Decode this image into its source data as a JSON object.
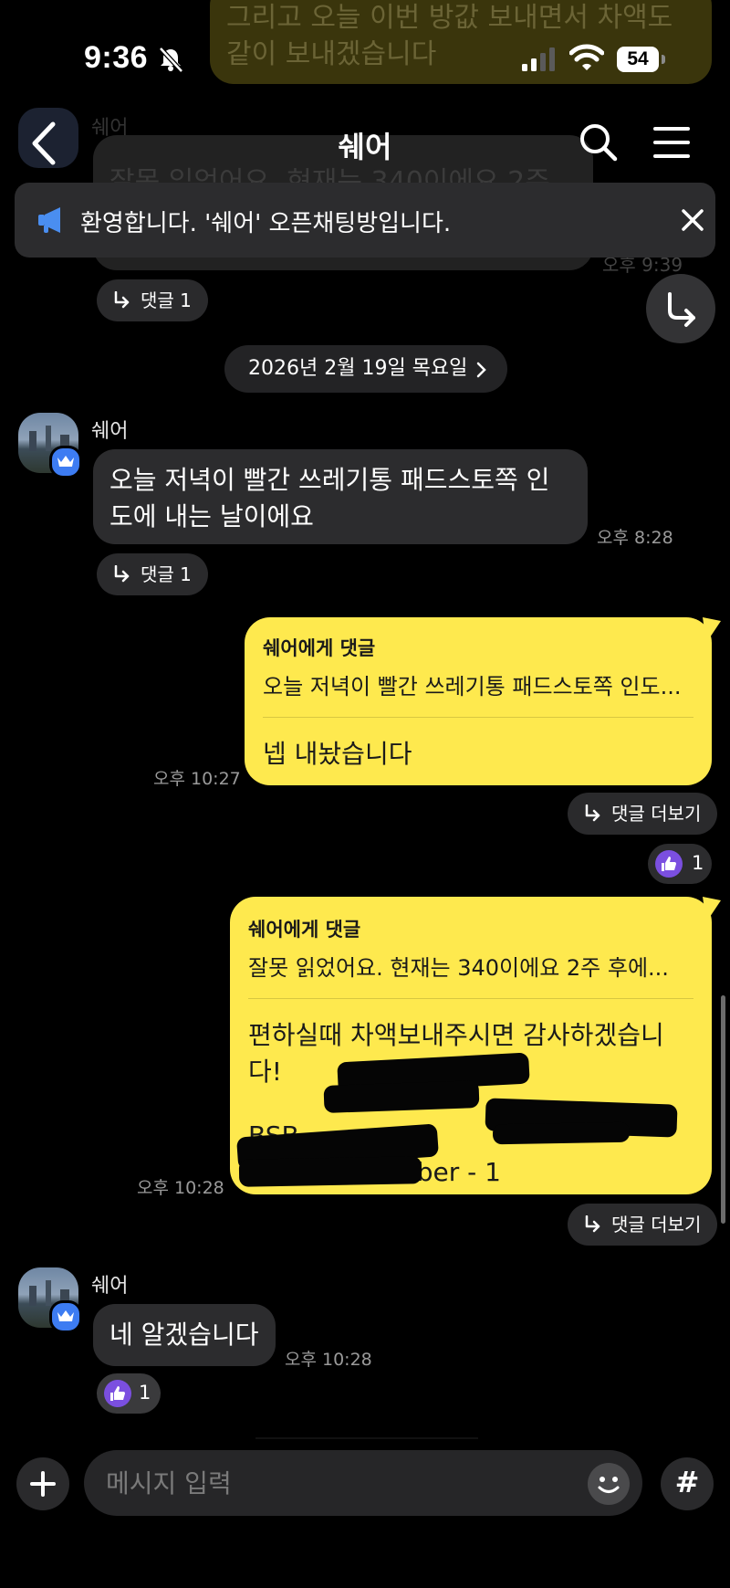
{
  "status_bar": {
    "time": "9:36",
    "battery": "54"
  },
  "ghost": {
    "yellow_text": "그리고 오늘 이번 방값 보내면서 차액도 같이 보내겠습니다",
    "gray_text": "잘못 읽었어요. 현재는 340이에요 2주 후에",
    "name": "쉐어",
    "time": "오후 9:39"
  },
  "header": {
    "title": "쉐어"
  },
  "notice": {
    "text": "환영합니다. '쉐어' 오픈채팅방입니다."
  },
  "labels": {
    "reply_count_label": "댓글 1",
    "more_replies_label": "댓글 더보기"
  },
  "date_divider": "2026년 2월 19일 목요일",
  "messages": [
    {
      "sender": "쉐어",
      "text": "오늘 저녁이 빨간 쓰레기통 패드스토쪽 인도에 내는 날이에요",
      "time": "오후 8:28"
    },
    {
      "reply_to_label": "쉐어에게 댓글",
      "quote": "오늘 저녁이 빨간 쓰레기통 패드스토쪽 인도...",
      "text": "넵 내놨습니다",
      "time": "오후 10:27",
      "reaction_count": "1"
    },
    {
      "reply_to_label": "쉐어에게 댓글",
      "quote": "잘못 읽었어요. 현재는 340이에요 2주 후에...",
      "text": "편하실때 차액보내주시면 감사하겠습니다!",
      "bsb_label": "BSB -",
      "account_label": "Account number - 1",
      "time": "오후 10:28"
    },
    {
      "sender": "쉐어",
      "text": "네 알겠습니다",
      "time": "오후 10:28",
      "reaction_count": "1"
    }
  ],
  "input": {
    "placeholder": "메시지 입력"
  },
  "colors": {
    "yellow_bubble": "#fee94e",
    "gray_bubble": "#2c2c2e",
    "crown_badge": "#3d7cf2",
    "reaction": "#7b4fe0"
  },
  "icons": [
    "back-icon",
    "search-icon",
    "menu-icon",
    "megaphone-icon",
    "close-icon",
    "reply-arrow-icon",
    "jump-down-icon",
    "chevron-right-icon",
    "crown-icon",
    "thumbs-up-icon",
    "plus-icon",
    "emoji-icon",
    "hash-icon"
  ]
}
